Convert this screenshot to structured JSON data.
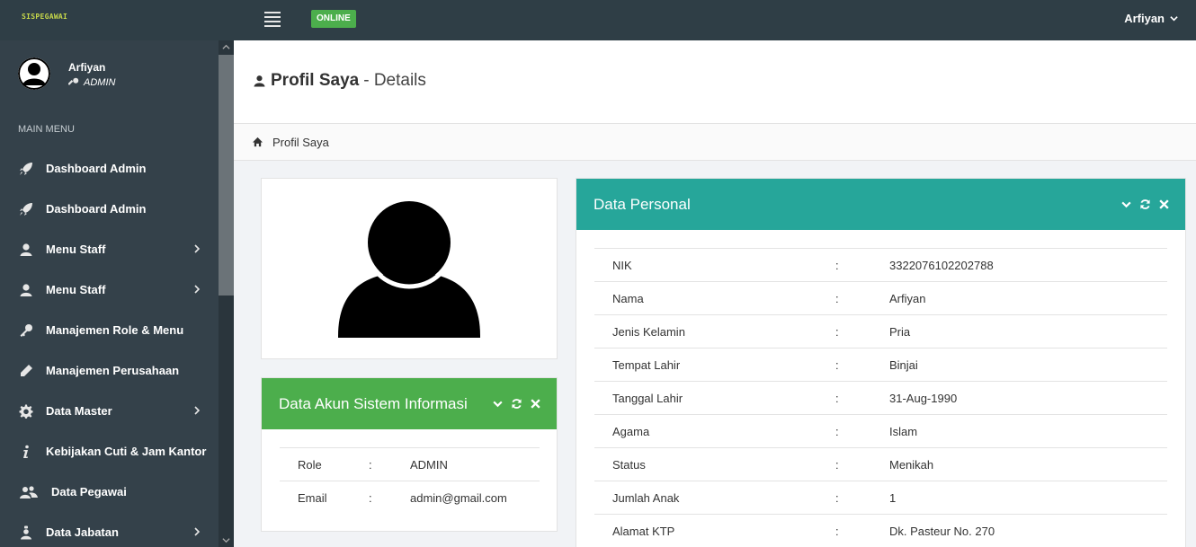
{
  "app": {
    "brand": "SISPEGAWAI",
    "status_badge": "ONLINE",
    "user_menu_label": "Arfiyan"
  },
  "sidebar": {
    "profile": {
      "name": "Arfiyan",
      "role": "ADMIN"
    },
    "section_label": "MAIN MENU",
    "items": [
      {
        "label": "Dashboard Admin",
        "icon": "rocket-icon",
        "has_submenu": false
      },
      {
        "label": "Dashboard Admin",
        "icon": "rocket-icon",
        "has_submenu": false
      },
      {
        "label": "Menu Staff",
        "icon": "user-icon",
        "has_submenu": true
      },
      {
        "label": "Menu Staff",
        "icon": "user-icon",
        "has_submenu": true
      },
      {
        "label": "Manajemen Role & Menu",
        "icon": "key-icon",
        "has_submenu": false
      },
      {
        "label": "Manajemen Perusahaan",
        "icon": "pencil-icon",
        "has_submenu": false
      },
      {
        "label": "Data Master",
        "icon": "gear-icon",
        "has_submenu": true
      },
      {
        "label": "Kebijakan Cuti & Jam Kantor",
        "icon": "info-icon",
        "has_submenu": false
      },
      {
        "label": "Data Pegawai",
        "icon": "users-icon",
        "has_submenu": false
      },
      {
        "label": "Data Jabatan",
        "icon": "id-badge-icon",
        "has_submenu": true
      }
    ]
  },
  "page": {
    "title": "Profil Saya",
    "subtitle": "- Details",
    "breadcrumb": "Profil Saya"
  },
  "akun_panel": {
    "title": "Data Akun Sistem Informasi",
    "rows": [
      {
        "label": "Role",
        "sep": ":",
        "value": "ADMIN"
      },
      {
        "label": "Email",
        "sep": ":",
        "value": "admin@gmail.com"
      }
    ]
  },
  "personal_panel": {
    "title": "Data Personal",
    "rows": [
      {
        "label": "NIK",
        "sep": ":",
        "value": "3322076102202788"
      },
      {
        "label": "Nama",
        "sep": ":",
        "value": "Arfiyan"
      },
      {
        "label": "Jenis Kelamin",
        "sep": ":",
        "value": "Pria"
      },
      {
        "label": "Tempat Lahir",
        "sep": ":",
        "value": "Binjai"
      },
      {
        "label": "Tanggal Lahir",
        "sep": ":",
        "value": "31-Aug-1990"
      },
      {
        "label": "Agama",
        "sep": ":",
        "value": "Islam"
      },
      {
        "label": "Status",
        "sep": ":",
        "value": "Menikah"
      },
      {
        "label": "Jumlah Anak",
        "sep": ":",
        "value": "1"
      },
      {
        "label": "Alamat KTP",
        "sep": ":",
        "value": "Dk. Pasteur No. 270"
      }
    ]
  },
  "colors": {
    "topbar": "#2f3e46",
    "sidebar": "#34414a",
    "online": "#4cae4c",
    "akun_header": "#4cae4c",
    "personal_header": "#26a69a"
  }
}
